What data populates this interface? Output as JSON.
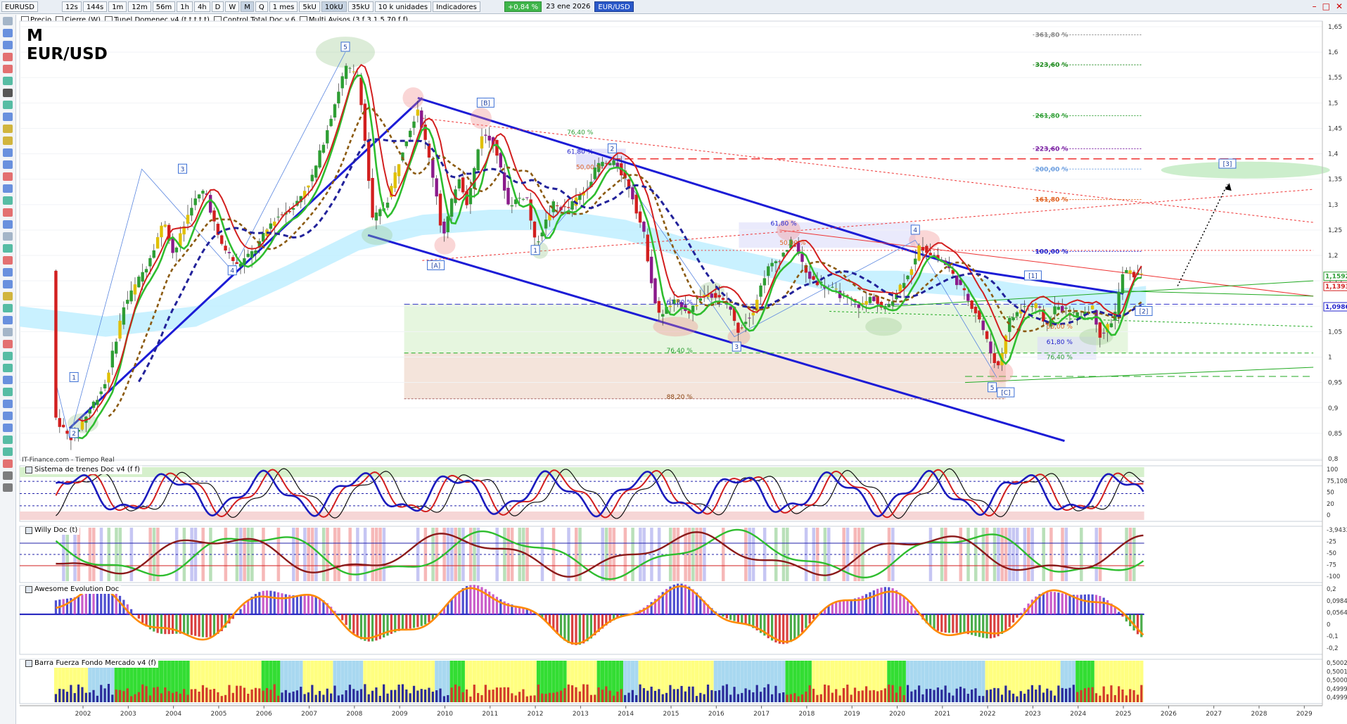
{
  "toolbar": {
    "symbol": "EURUSD",
    "timeframes": [
      "12s",
      "144s",
      "1m",
      "12m",
      "56m",
      "1h",
      "4h",
      "D",
      "W",
      "M",
      "Q"
    ],
    "active_timeframe": "M",
    "period": "1 mes",
    "volume_units": [
      "5kU",
      "10kU",
      "35kU"
    ],
    "active_volume": "10kU",
    "unit_mode": "10 k unidades",
    "indicators_label": "Indicadores",
    "change_badge": "+0,84 %",
    "date": "23 ene 2026",
    "pair_badge": "EUR/USD"
  },
  "legend": [
    "Precio",
    "Cierre (W)",
    "Tunel Domenec v4 (t t t t t)",
    "Control Total Doc v.6",
    "Multi Avisos (3 f 3 1,5 70 f f)"
  ],
  "title": {
    "timeframe": "M",
    "pair": "EUR/USD"
  },
  "source": "IT-Finance.com - Tiempo Real",
  "panels": {
    "p1": "Sistema de trenes Doc v4 (f f)",
    "p2": "Willy Doc (t)",
    "p3": "Awesome Evolution Doc",
    "p4": "Barra Fuerza Fondo Mercado v4 (f)"
  },
  "colors": {
    "up": "#2e9e34",
    "down": "#d21f1f",
    "blue_line": "#2222cc",
    "accent_green": "#3fb54a"
  },
  "chart_data": {
    "type": "candlestick",
    "xlabel": "",
    "ylabel": "",
    "years": [
      "2002",
      "2003",
      "2004",
      "2005",
      "2006",
      "2007",
      "2008",
      "2009",
      "2010",
      "2011",
      "2012",
      "2013",
      "2014",
      "2015",
      "2016",
      "2017",
      "2018",
      "2019",
      "2020",
      "2021",
      "2022",
      "2023",
      "2024",
      "2025",
      "2026",
      "2027",
      "2028",
      "2029"
    ],
    "ylim": [
      0.8,
      1.65
    ],
    "yticks": [
      "1,65",
      "1,6",
      "1,55",
      "1,5",
      "1,45",
      "1,4",
      "1,35",
      "1,3",
      "1,25",
      "1,2",
      "1,15",
      "1,1",
      "1,05",
      "1",
      "0,95",
      "0,9",
      "0,85",
      "0,8"
    ],
    "price_anchors": [
      [
        2001.9,
        0.88
      ],
      [
        2002.2,
        0.84
      ],
      [
        2002.4,
        0.86
      ],
      [
        2003.0,
        0.95
      ],
      [
        2003.4,
        1.1
      ],
      [
        2003.9,
        1.18
      ],
      [
        2004.3,
        1.27
      ],
      [
        2004.5,
        1.2
      ],
      [
        2004.9,
        1.3
      ],
      [
        2005.2,
        1.33
      ],
      [
        2005.5,
        1.23
      ],
      [
        2005.9,
        1.18
      ],
      [
        2006.3,
        1.21
      ],
      [
        2006.7,
        1.27
      ],
      [
        2007.2,
        1.3
      ],
      [
        2007.6,
        1.36
      ],
      [
        2007.9,
        1.45
      ],
      [
        2008.3,
        1.57
      ],
      [
        2008.6,
        1.55
      ],
      [
        2008.9,
        1.27
      ],
      [
        2009.2,
        1.3
      ],
      [
        2009.6,
        1.42
      ],
      [
        2009.9,
        1.49
      ],
      [
        2010.3,
        1.33
      ],
      [
        2010.45,
        1.23
      ],
      [
        2010.8,
        1.36
      ],
      [
        2011.0,
        1.3
      ],
      [
        2011.3,
        1.44
      ],
      [
        2011.6,
        1.42
      ],
      [
        2011.9,
        1.3
      ],
      [
        2012.3,
        1.32
      ],
      [
        2012.5,
        1.22
      ],
      [
        2012.9,
        1.3
      ],
      [
        2013.2,
        1.29
      ],
      [
        2013.6,
        1.33
      ],
      [
        2013.9,
        1.38
      ],
      [
        2014.3,
        1.38
      ],
      [
        2014.6,
        1.33
      ],
      [
        2014.9,
        1.24
      ],
      [
        2015.2,
        1.08
      ],
      [
        2015.6,
        1.11
      ],
      [
        2015.9,
        1.09
      ],
      [
        2016.3,
        1.13
      ],
      [
        2016.8,
        1.1
      ],
      [
        2016.95,
        1.05
      ],
      [
        2017.3,
        1.09
      ],
      [
        2017.6,
        1.17
      ],
      [
        2017.95,
        1.2
      ],
      [
        2018.2,
        1.23
      ],
      [
        2018.5,
        1.16
      ],
      [
        2018.9,
        1.14
      ],
      [
        2019.3,
        1.12
      ],
      [
        2019.7,
        1.1
      ],
      [
        2019.95,
        1.12
      ],
      [
        2020.2,
        1.09
      ],
      [
        2020.5,
        1.13
      ],
      [
        2020.9,
        1.19
      ],
      [
        2021.0,
        1.22
      ],
      [
        2021.3,
        1.2
      ],
      [
        2021.6,
        1.18
      ],
      [
        2021.95,
        1.13
      ],
      [
        2022.3,
        1.08
      ],
      [
        2022.6,
        1.0
      ],
      [
        2022.75,
        0.98
      ],
      [
        2022.95,
        1.07
      ],
      [
        2023.3,
        1.1
      ],
      [
        2023.6,
        1.1
      ],
      [
        2023.8,
        1.06
      ],
      [
        2024.0,
        1.1
      ],
      [
        2024.5,
        1.08
      ],
      [
        2024.8,
        1.1
      ],
      [
        2025.0,
        1.04
      ],
      [
        2025.3,
        1.08
      ],
      [
        2025.5,
        1.17
      ],
      [
        2025.8,
        1.16
      ],
      [
        2025.95,
        1.17
      ]
    ],
    "last_price": "1,15924",
    "price_labels": [
      {
        "value": 1.159,
        "text": "1,15924",
        "color": "#2e9e34"
      },
      {
        "value": 1.139,
        "text": "1,13938",
        "color": "#d21f1f"
      },
      {
        "value": 1.099,
        "text": "1,09867",
        "color": "#2222cc"
      }
    ],
    "fib_right": [
      {
        "text": "361,80 %",
        "value": 1.634,
        "color": "#888888"
      },
      {
        "text": "323,60 %",
        "value": 1.575,
        "color": "#1c8a1c"
      },
      {
        "text": "261,80 %",
        "value": 1.475,
        "color": "#2e9e34"
      },
      {
        "text": "223,60 %",
        "value": 1.41,
        "color": "#7a1fa2"
      },
      {
        "text": "200,00 %",
        "value": 1.37,
        "color": "#6fa0e0"
      },
      {
        "text": "161,80 %",
        "value": 1.31,
        "color": "#e06020"
      },
      {
        "text": "100,00 %",
        "value": 1.208,
        "color": "#2222cc"
      },
      {
        "text": "50,00 %",
        "value": 1.06,
        "color": "#e06020"
      },
      {
        "text": "61,80 %",
        "value": 1.03,
        "color": "#2222cc"
      },
      {
        "text": "76,40 %",
        "value": 1.0,
        "color": "#2e9e34"
      }
    ],
    "fib_left": [
      {
        "text": "76,40 %",
        "value": 1.442,
        "color": "#2e9e34"
      },
      {
        "text": "61,80 %",
        "value": 1.404,
        "color": "#2222cc"
      },
      {
        "text": "50,00 %",
        "value": 1.374,
        "color": "#e06020"
      },
      {
        "text": "61,80 %",
        "value": 1.263,
        "color": "#2222cc"
      },
      {
        "text": "50,00 %",
        "value": 1.225,
        "color": "#e06020"
      },
      {
        "text": "61,80 %",
        "value": 1.108,
        "color": "#2222cc"
      },
      {
        "text": "76,40 %",
        "value": 1.013,
        "color": "#2e9e34"
      },
      {
        "text": "88,20 %",
        "value": 0.922,
        "color": "#8b4513"
      }
    ],
    "wave_labels": [
      {
        "text": "1",
        "year": 2002.3,
        "value": 0.96
      },
      {
        "text": "2",
        "year": 2002.3,
        "value": 0.85
      },
      {
        "text": "3",
        "year": 2004.7,
        "value": 1.37
      },
      {
        "text": "4",
        "year": 2005.8,
        "value": 1.17
      },
      {
        "text": "5",
        "year": 2008.3,
        "value": 1.61
      },
      {
        "text": "[A]",
        "year": 2010.3,
        "value": 1.18
      },
      {
        "text": "[B]",
        "year": 2011.4,
        "value": 1.5
      },
      {
        "text": "2",
        "year": 2014.2,
        "value": 1.41
      },
      {
        "text": "1",
        "year": 2012.5,
        "value": 1.21
      },
      {
        "text": "3",
        "year": 2016.95,
        "value": 1.02
      },
      {
        "text": "4",
        "year": 2020.9,
        "value": 1.25
      },
      {
        "text": "5",
        "year": 2022.6,
        "value": 0.94
      },
      {
        "text": "[C]",
        "year": 2022.9,
        "value": 0.93
      },
      {
        "text": "[1]",
        "year": 2023.5,
        "value": 1.16
      },
      {
        "text": "[2]",
        "year": 2025.95,
        "value": 1.09
      },
      {
        "text": "[3]",
        "year": 2027.8,
        "value": 1.38
      }
    ],
    "osc1_ticks": [
      "100",
      "75,108",
      "50",
      "20",
      "0"
    ],
    "osc2_ticks": [
      "-3,9433",
      "-25",
      "-50",
      "-75",
      "-100"
    ],
    "osc3_ticks": [
      "0,2",
      "0,0984",
      "0,0564",
      "0",
      "-0,1",
      "-0,2"
    ],
    "osc4_ticks": [
      "0,5002",
      "0,5001",
      "0,50000",
      "0,49994",
      "0,49995"
    ]
  }
}
